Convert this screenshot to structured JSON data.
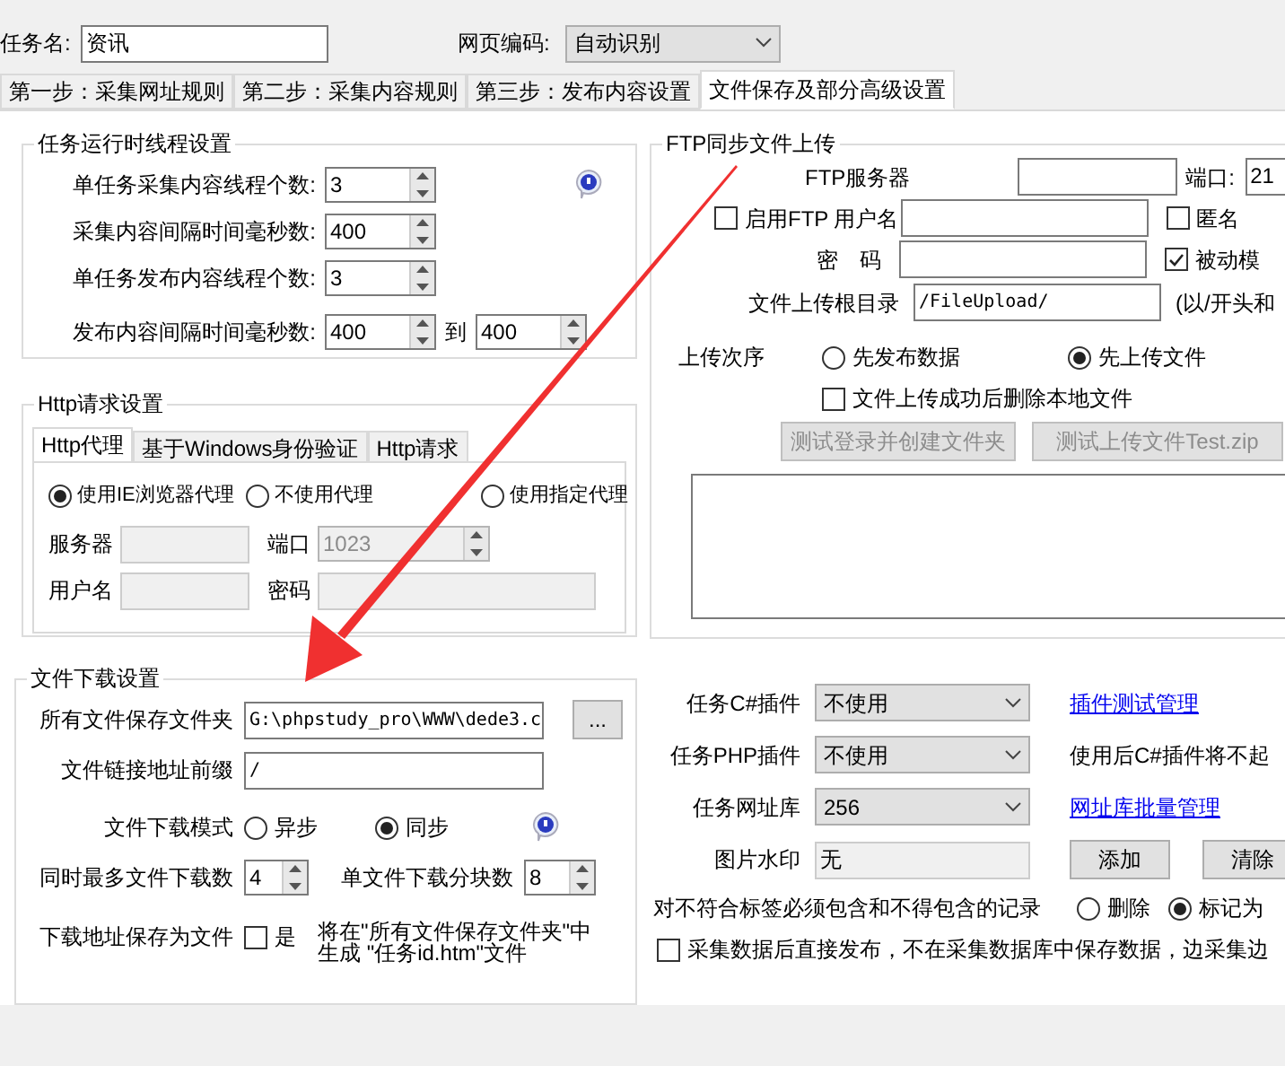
{
  "task_name": {
    "label": "任务名:",
    "value": "资讯"
  },
  "encoding": {
    "label": "网页编码:",
    "value": "自动识别"
  },
  "tabs": [
    {
      "label": "第一步：采集网址规则",
      "selected": false
    },
    {
      "label": "第二步：采集内容规则",
      "selected": false
    },
    {
      "label": "第三步：发布内容设置",
      "selected": false
    },
    {
      "label": "文件保存及部分高级设置",
      "selected": true
    }
  ],
  "thread_settings": {
    "title": "任务运行时线程设置",
    "rows": [
      {
        "label": "单任务采集内容线程个数:",
        "value": "3"
      },
      {
        "label": "采集内容间隔时间毫秒数:",
        "value": "400"
      },
      {
        "label": "单任务发布内容线程个数:",
        "value": "3"
      },
      {
        "label": "发布内容间隔时间毫秒数:",
        "value": "400",
        "to_label": "到",
        "to_value": "400"
      }
    ]
  },
  "http": {
    "title": "Http请求设置",
    "tabs": [
      {
        "label": "Http代理",
        "selected": true
      },
      {
        "label": "基于Windows身份验证",
        "selected": false
      },
      {
        "label": "Http请求",
        "selected": false
      }
    ],
    "proxy_options": [
      {
        "label": "使用IE浏览器代理",
        "selected": true
      },
      {
        "label": "不使用代理",
        "selected": false
      },
      {
        "label": "使用指定代理",
        "selected": false
      }
    ],
    "server_label": "服务器",
    "port_label": "端口",
    "port_value": "1023",
    "user_label": "用户名",
    "password_label": "密码"
  },
  "download": {
    "title": "文件下载设置",
    "folder_label": "所有文件保存文件夹",
    "folder_value": "G:\\phpstudy_pro\\WWW\\dede3.c",
    "browse_label": "...",
    "prefix_label": "文件链接地址前缀",
    "prefix_value": "/",
    "mode_label": "文件下载模式",
    "modes": [
      {
        "label": "异步",
        "selected": false
      },
      {
        "label": "同步",
        "selected": true
      }
    ],
    "concurrent_label": "同时最多文件下载数",
    "concurrent_value": "4",
    "chunks_label": "单文件下载分块数",
    "chunks_value": "8",
    "save_label": "下载地址保存为文件",
    "save_checkbox": {
      "label": "是",
      "checked": false
    },
    "save_note": "将在\"所有文件保存文件夹\"中生成 \"任务id.htm\"文件"
  },
  "ftp": {
    "title": "FTP同步文件上传",
    "server_label": "FTP服务器",
    "port_label": "端口:",
    "port_value": "21",
    "enable": {
      "label": "启用FTP",
      "checked": false
    },
    "user_label": "用户名",
    "anonymous": {
      "label": "匿名",
      "checked": false
    },
    "password_label": "密　码",
    "passive": {
      "label": "被动模",
      "checked": true
    },
    "root_label": "文件上传根目录",
    "root_value": "/FileUpload/",
    "root_hint": "(以/开头和",
    "order_label": "上传次序",
    "order_options": [
      {
        "label": "先发布数据",
        "selected": false
      },
      {
        "label": "先上传文件",
        "selected": true
      }
    ],
    "delete_local": {
      "label": "文件上传成功后删除本地文件",
      "checked": false
    },
    "buttons": [
      {
        "label": "测试登录并创建文件夹",
        "disabled": true
      },
      {
        "label": "测试上传文件Test.zip",
        "disabled": true
      }
    ]
  },
  "plugins": {
    "csharp_label": "任务C#插件",
    "csharp_value": "不使用",
    "csharp_link": "插件测试管理",
    "php_label": "任务PHP插件",
    "php_value": "不使用",
    "php_note": "使用后C#插件将不起",
    "urldb_label": "任务网址库",
    "urldb_value": "256",
    "urldb_link": "网址库批量管理",
    "watermark_label": "图片水印",
    "watermark_value": "无",
    "add_button": "添加",
    "clear_button": "清除",
    "record_label": "对不符合标签必须包含和不得包含的记录",
    "record_options": [
      {
        "label": "删除",
        "selected": false
      },
      {
        "label": "标记为",
        "selected": true
      }
    ],
    "direct_publish": {
      "label": "采集数据后直接发布，不在采集数据库中保存数据，边采集边",
      "checked": false
    }
  }
}
